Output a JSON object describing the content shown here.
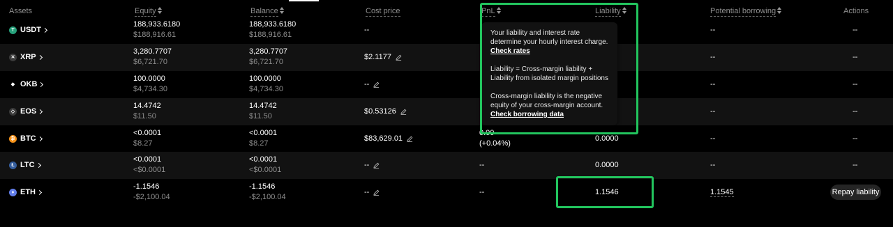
{
  "columns": {
    "assets": "Assets",
    "equity": "Equity",
    "balance": "Balance",
    "cost_price": "Cost price",
    "pnl": "PnL",
    "liability": "Liability",
    "potential_borrowing": "Potential borrowing",
    "actions": "Actions"
  },
  "rows": [
    {
      "symbol": "USDT",
      "equity": "188,933.6180",
      "equity_usd": "$188,916.61",
      "balance": "188,933.6180",
      "balance_usd": "$188,916.61",
      "cost": "--",
      "pnl": "",
      "pnl_pct": "",
      "liability": "",
      "potential": "--",
      "action": "--"
    },
    {
      "symbol": "XRP",
      "equity": "3,280.7707",
      "equity_usd": "$6,721.70",
      "balance": "3,280.7707",
      "balance_usd": "$6,721.70",
      "cost": "$2.1177",
      "pnl": "",
      "pnl_pct": "",
      "liability": "",
      "potential": "--",
      "action": "--"
    },
    {
      "symbol": "OKB",
      "equity": "100.0000",
      "equity_usd": "$4,734.30",
      "balance": "100.0000",
      "balance_usd": "$4,734.30",
      "cost": "--",
      "pnl": "",
      "pnl_pct": "",
      "liability": "",
      "potential": "--",
      "action": "--"
    },
    {
      "symbol": "EOS",
      "equity": "14.4742",
      "equity_usd": "$11.50",
      "balance": "14.4742",
      "balance_usd": "$11.50",
      "cost": "$0.53126",
      "pnl": "",
      "pnl_pct": "",
      "liability": "",
      "potential": "--",
      "action": "--"
    },
    {
      "symbol": "BTC",
      "equity": "<0.0001",
      "equity_usd": "$8.27",
      "balance": "<0.0001",
      "balance_usd": "$8.27",
      "cost": "$83,629.01",
      "pnl": "0.00",
      "pnl_pct": "(+0.04%)",
      "liability": "0.0000",
      "potential": "--",
      "action": "--"
    },
    {
      "symbol": "LTC",
      "equity": "<0.0001",
      "equity_usd": "<$0.0001",
      "balance": "<0.0001",
      "balance_usd": "<$0.0001",
      "cost": "--",
      "pnl": "--",
      "pnl_pct": "",
      "liability": "0.0000",
      "potential": "--",
      "action": "--"
    },
    {
      "symbol": "ETH",
      "equity": "-1.1546",
      "equity_usd": "-$2,100.04",
      "balance": "-1.1546",
      "balance_usd": "-$2,100.04",
      "cost": "--",
      "pnl": "--",
      "pnl_pct": "",
      "liability": "1.1546",
      "potential": "1.1545",
      "action": "Repay liability"
    }
  ],
  "tooltip": {
    "p1_text": "Your liability and interest rate determine your hourly interest charge.",
    "p1_link": "Check rates",
    "p2_text": "Liability = Cross-margin liability + Liability from isolated margin positions",
    "p3_text": "Cross-margin liability is the negative equity of your cross-margin account.",
    "p3_link": "Check borrowing data"
  },
  "coin_colors": {
    "USDT": "#26a17b",
    "XRP": "#3a3a3a",
    "OKB": "#000000",
    "EOS": "#3a3a3a",
    "BTC": "#f7931a",
    "LTC": "#345d9d",
    "ETH": "#627eea"
  },
  "coin_glyphs": {
    "USDT": "T",
    "XRP": "✕",
    "OKB": "◆",
    "EOS": "◇",
    "BTC": "₿",
    "LTC": "Ł",
    "ETH": "♦"
  },
  "highlight_color": "#22c55e"
}
